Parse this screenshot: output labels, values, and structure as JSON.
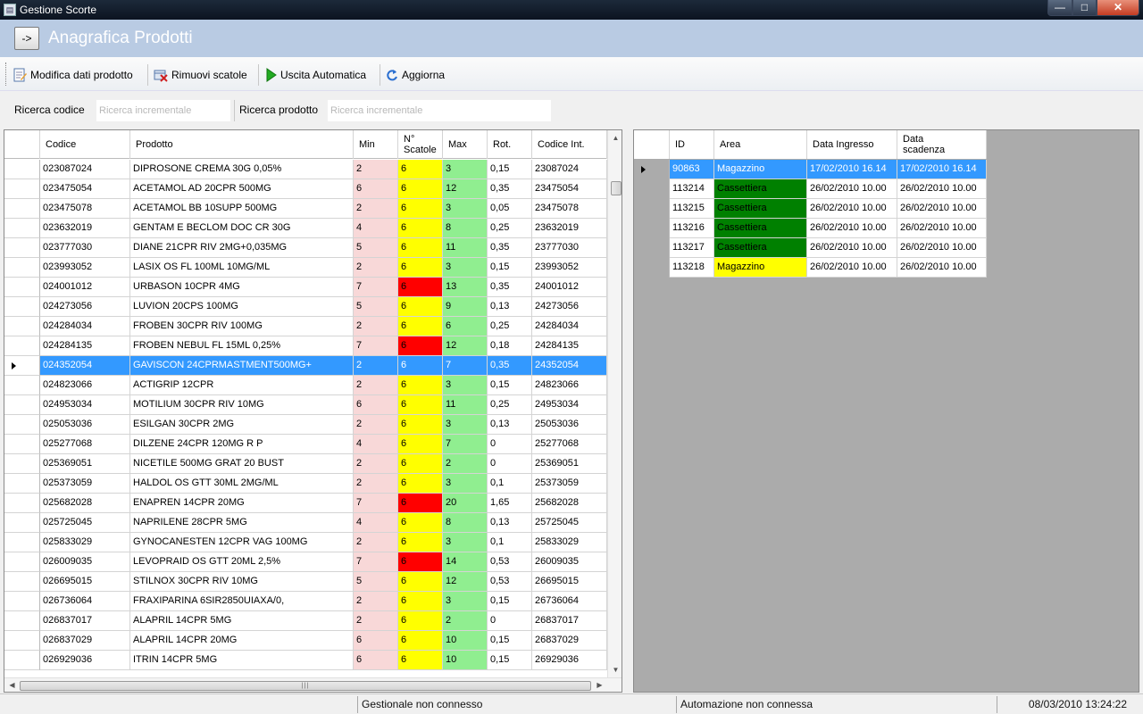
{
  "window": {
    "title": "Gestione Scorte",
    "minimize_glyph": "—",
    "maximize_glyph": "□",
    "close_glyph": "✕"
  },
  "header": {
    "nav_label": "->",
    "title": "Anagrafica Prodotti"
  },
  "toolbar": {
    "edit_label": "Modifica dati prodotto",
    "remove_label": "Rimuovi scatole",
    "auto_exit_label": "Uscita Automatica",
    "refresh_label": "Aggiorna"
  },
  "search": {
    "code_label": "Ricerca codice",
    "code_placeholder": "Ricerca incrementale",
    "product_label": "Ricerca prodotto",
    "product_placeholder": "Ricerca incrementale"
  },
  "products": {
    "columns": [
      "Codice",
      "Prodotto",
      "Min",
      "N° Scatole",
      "Max",
      "Rot.",
      "Codice Int."
    ],
    "rows": [
      {
        "codice": "023087024",
        "prodotto": "DIPROSONE CREMA 30G 0,05%",
        "min": "2",
        "scatole": "6",
        "max": "3",
        "rot": "0,15",
        "int": "23087024",
        "status": "ok"
      },
      {
        "codice": "023475054",
        "prodotto": "ACETAMOL AD 20CPR 500MG",
        "min": "6",
        "scatole": "6",
        "max": "12",
        "rot": "0,35",
        "int": "23475054",
        "status": "ok"
      },
      {
        "codice": "023475078",
        "prodotto": "ACETAMOL BB 10SUPP 500MG",
        "min": "2",
        "scatole": "6",
        "max": "3",
        "rot": "0,05",
        "int": "23475078",
        "status": "ok"
      },
      {
        "codice": "023632019",
        "prodotto": "GENTAM E BECLOM DOC CR 30G",
        "min": "4",
        "scatole": "6",
        "max": "8",
        "rot": "0,25",
        "int": "23632019",
        "status": "ok"
      },
      {
        "codice": "023777030",
        "prodotto": "DIANE 21CPR RIV 2MG+0,035MG",
        "min": "5",
        "scatole": "6",
        "max": "11",
        "rot": "0,35",
        "int": "23777030",
        "status": "ok"
      },
      {
        "codice": "023993052",
        "prodotto": "LASIX OS FL 100ML 10MG/ML",
        "min": "2",
        "scatole": "6",
        "max": "3",
        "rot": "0,15",
        "int": "23993052",
        "status": "ok"
      },
      {
        "codice": "024001012",
        "prodotto": "URBASON 10CPR 4MG",
        "min": "7",
        "scatole": "6",
        "max": "13",
        "rot": "0,35",
        "int": "24001012",
        "status": "low"
      },
      {
        "codice": "024273056",
        "prodotto": "LUVION 20CPS 100MG",
        "min": "5",
        "scatole": "6",
        "max": "9",
        "rot": "0,13",
        "int": "24273056",
        "status": "ok"
      },
      {
        "codice": "024284034",
        "prodotto": "FROBEN 30CPR RIV 100MG",
        "min": "2",
        "scatole": "6",
        "max": "6",
        "rot": "0,25",
        "int": "24284034",
        "status": "ok"
      },
      {
        "codice": "024284135",
        "prodotto": "FROBEN NEBUL FL 15ML 0,25%",
        "min": "7",
        "scatole": "6",
        "max": "12",
        "rot": "0,18",
        "int": "24284135",
        "status": "low"
      },
      {
        "codice": "024352054",
        "prodotto": "GAVISCON 24CPRMASTMENT500MG+",
        "min": "2",
        "scatole": "6",
        "max": "7",
        "rot": "0,35",
        "int": "24352054",
        "status": "ok",
        "selected": true
      },
      {
        "codice": "024823066",
        "prodotto": "ACTIGRIP 12CPR",
        "min": "2",
        "scatole": "6",
        "max": "3",
        "rot": "0,15",
        "int": "24823066",
        "status": "ok"
      },
      {
        "codice": "024953034",
        "prodotto": "MOTILIUM 30CPR RIV 10MG",
        "min": "6",
        "scatole": "6",
        "max": "11",
        "rot": "0,25",
        "int": "24953034",
        "status": "ok"
      },
      {
        "codice": "025053036",
        "prodotto": "ESILGAN 30CPR 2MG",
        "min": "2",
        "scatole": "6",
        "max": "3",
        "rot": "0,13",
        "int": "25053036",
        "status": "ok"
      },
      {
        "codice": "025277068",
        "prodotto": "DILZENE 24CPR 120MG R P",
        "min": "4",
        "scatole": "6",
        "max": "7",
        "rot": "0",
        "int": "25277068",
        "status": "ok"
      },
      {
        "codice": "025369051",
        "prodotto": "NICETILE 500MG GRAT 20 BUST",
        "min": "2",
        "scatole": "6",
        "max": "2",
        "rot": "0",
        "int": "25369051",
        "status": "ok"
      },
      {
        "codice": "025373059",
        "prodotto": "HALDOL OS GTT 30ML 2MG/ML",
        "min": "2",
        "scatole": "6",
        "max": "3",
        "rot": "0,1",
        "int": "25373059",
        "status": "ok"
      },
      {
        "codice": "025682028",
        "prodotto": "ENAPREN 14CPR 20MG",
        "min": "7",
        "scatole": "6",
        "max": "20",
        "rot": "1,65",
        "int": "25682028",
        "status": "low"
      },
      {
        "codice": "025725045",
        "prodotto": "NAPRILENE 28CPR 5MG",
        "min": "4",
        "scatole": "6",
        "max": "8",
        "rot": "0,13",
        "int": "25725045",
        "status": "ok"
      },
      {
        "codice": "025833029",
        "prodotto": "GYNOCANESTEN 12CPR VAG 100MG",
        "min": "2",
        "scatole": "6",
        "max": "3",
        "rot": "0,1",
        "int": "25833029",
        "status": "ok"
      },
      {
        "codice": "026009035",
        "prodotto": "LEVOPRAID OS GTT 20ML 2,5%",
        "min": "7",
        "scatole": "6",
        "max": "14",
        "rot": "0,53",
        "int": "26009035",
        "status": "low"
      },
      {
        "codice": "026695015",
        "prodotto": "STILNOX 30CPR RIV 10MG",
        "min": "5",
        "scatole": "6",
        "max": "12",
        "rot": "0,53",
        "int": "26695015",
        "status": "ok"
      },
      {
        "codice": "026736064",
        "prodotto": "FRAXIPARINA 6SIR2850UIAXA/0,",
        "min": "2",
        "scatole": "6",
        "max": "3",
        "rot": "0,15",
        "int": "26736064",
        "status": "ok"
      },
      {
        "codice": "026837017",
        "prodotto": "ALAPRIL 14CPR 5MG",
        "min": "2",
        "scatole": "6",
        "max": "2",
        "rot": "0",
        "int": "26837017",
        "status": "ok"
      },
      {
        "codice": "026837029",
        "prodotto": "ALAPRIL 14CPR 20MG",
        "min": "6",
        "scatole": "6",
        "max": "10",
        "rot": "0,15",
        "int": "26837029",
        "status": "ok"
      },
      {
        "codice": "026929036",
        "prodotto": "ITRIN 14CPR 5MG",
        "min": "6",
        "scatole": "6",
        "max": "10",
        "rot": "0,15",
        "int": "26929036",
        "status": "ok"
      }
    ]
  },
  "boxes": {
    "columns": [
      "ID",
      "Area",
      "Data Ingresso",
      "Data scadenza"
    ],
    "rows": [
      {
        "id": "90863",
        "area": "Magazzino",
        "ingresso": "17/02/2010 16.14",
        "scadenza": "17/02/2010 16.14",
        "selected": true
      },
      {
        "id": "113214",
        "area": "Cassettiera",
        "ingresso": "26/02/2010 10.00",
        "scadenza": "26/02/2010 10.00"
      },
      {
        "id": "113215",
        "area": "Cassettiera",
        "ingresso": "26/02/2010 10.00",
        "scadenza": "26/02/2010 10.00"
      },
      {
        "id": "113216",
        "area": "Cassettiera",
        "ingresso": "26/02/2010 10.00",
        "scadenza": "26/02/2010 10.00"
      },
      {
        "id": "113217",
        "area": "Cassettiera",
        "ingresso": "26/02/2010 10.00",
        "scadenza": "26/02/2010 10.00"
      },
      {
        "id": "113218",
        "area": "Magazzino",
        "ingresso": "26/02/2010 10.00",
        "scadenza": "26/02/2010 10.00"
      }
    ]
  },
  "colors": {
    "min_bg": "#f8d8d8",
    "boxes_ok": "#ffff00",
    "boxes_low": "#ff0000",
    "max_bg": "#90ee90",
    "cassettiera": "#008000",
    "magazzino": "#ffff00",
    "selection": "#3399ff",
    "header_band": "#b9cbe3"
  },
  "icons": {
    "edit": "edit-document-icon",
    "remove": "remove-boxes-icon",
    "auto_exit": "play-arrow-icon",
    "refresh": "refresh-icon"
  },
  "status": {
    "gestionale": "Gestionale non connesso",
    "automazione": "Automazione non connessa",
    "datetime": "08/03/2010 13:24:22"
  }
}
